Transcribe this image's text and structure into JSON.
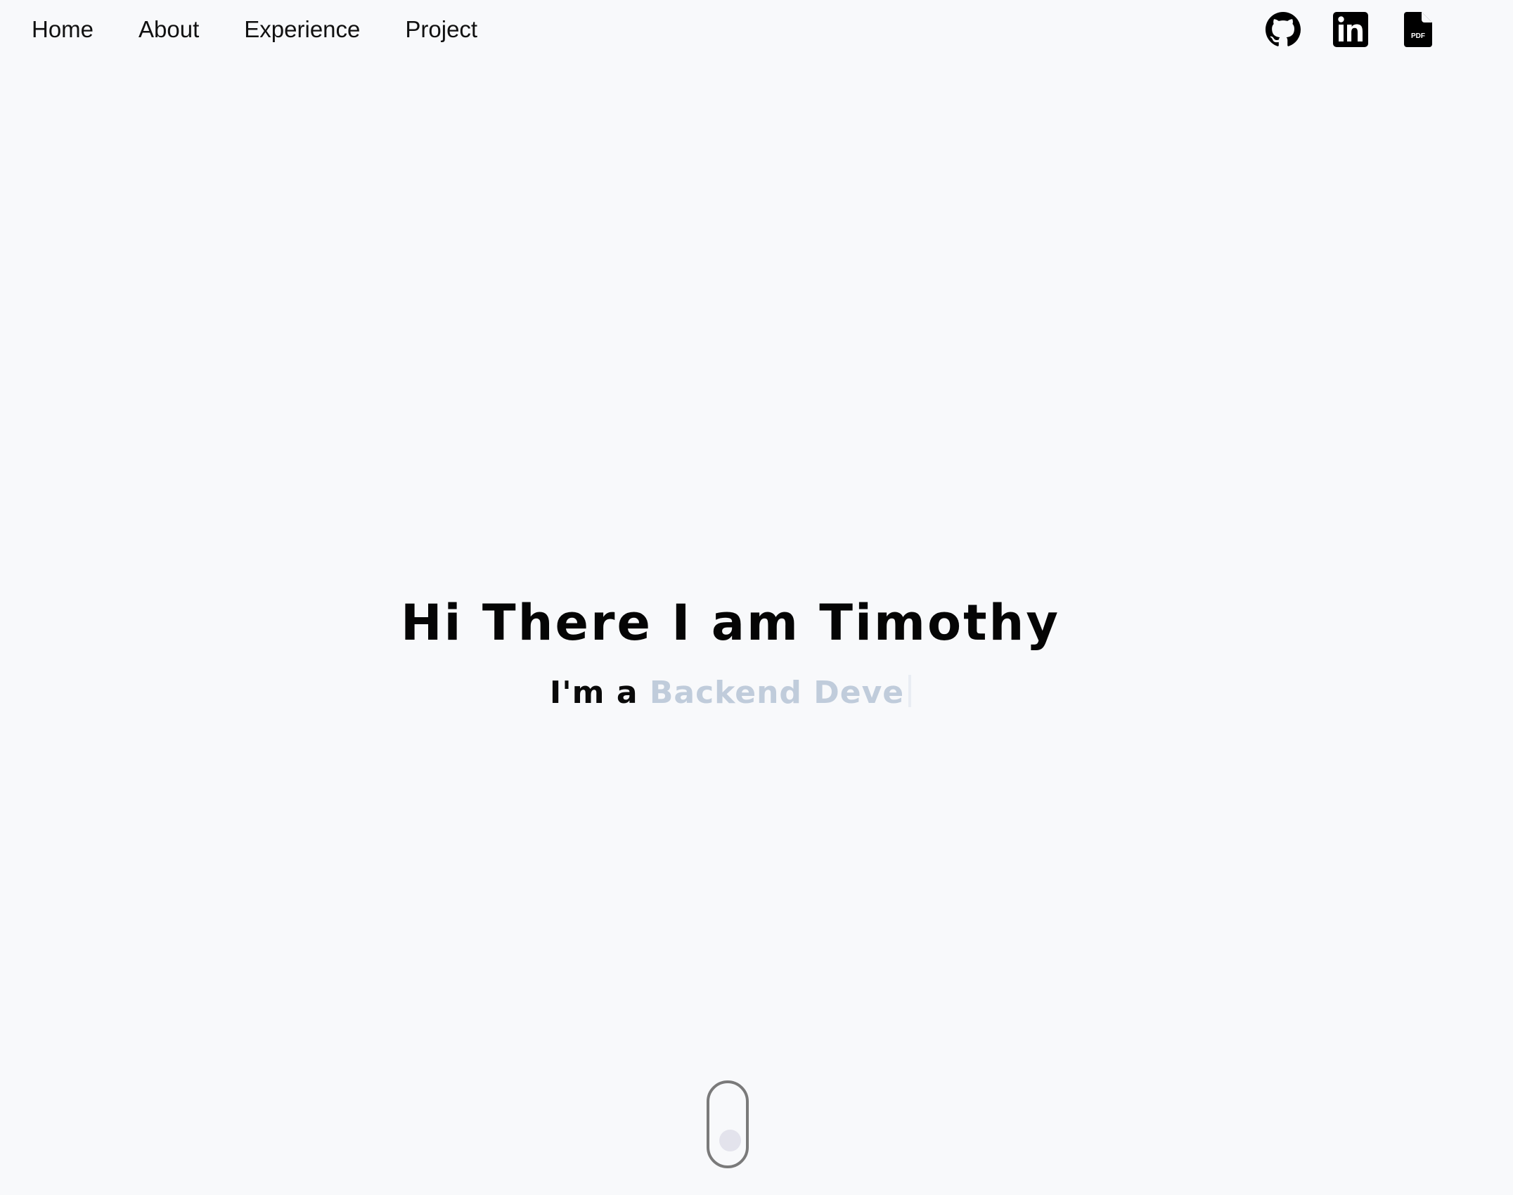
{
  "nav": {
    "links": [
      {
        "label": "Home"
      },
      {
        "label": "About"
      },
      {
        "label": "Experience"
      },
      {
        "label": "Project"
      }
    ],
    "social": [
      {
        "icon": "github-icon"
      },
      {
        "icon": "linkedin-icon"
      },
      {
        "icon": "pdf-icon",
        "label": "PDF"
      }
    ]
  },
  "hero": {
    "title": "Hi There I am Timothy",
    "subtitle_prefix": "I'm a",
    "typed_text": "Backend Deve"
  },
  "colors": {
    "background": "#f8f9fb",
    "text": "#000000",
    "typed_accent": "#c0ccdb",
    "scroll_border": "#7a7a7a",
    "scroll_dot": "#e3e3ec"
  }
}
